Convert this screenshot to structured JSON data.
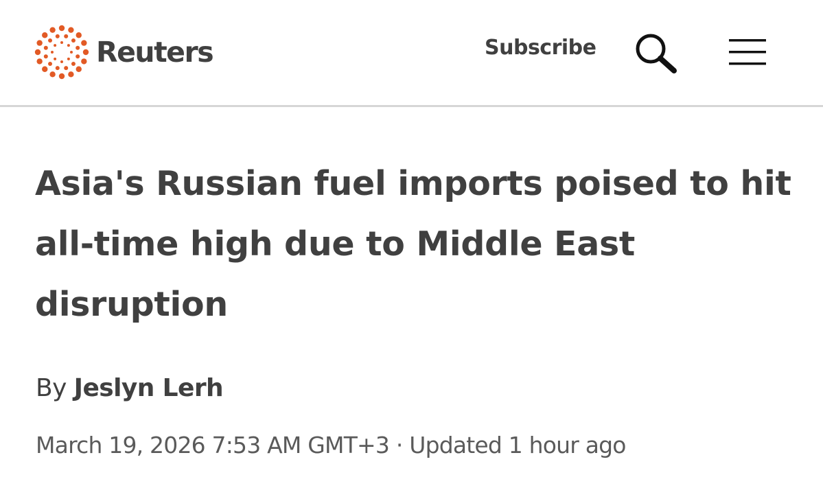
{
  "header": {
    "brand": "Reuters",
    "subscribe_label": "Subscribe",
    "logo_color": "#e25a25",
    "search_icon": "search-icon",
    "menu_icon": "hamburger-menu-icon"
  },
  "article": {
    "headline": "Asia's Russian fuel imports poised to hit all-time high due to Middle East disruption",
    "byline_prefix": "By",
    "author": "Jeslyn Lerh",
    "published": "March 19, 2026 7:53 AM GMT+3",
    "separator": "·",
    "updated": "Updated 1 hour ago"
  }
}
